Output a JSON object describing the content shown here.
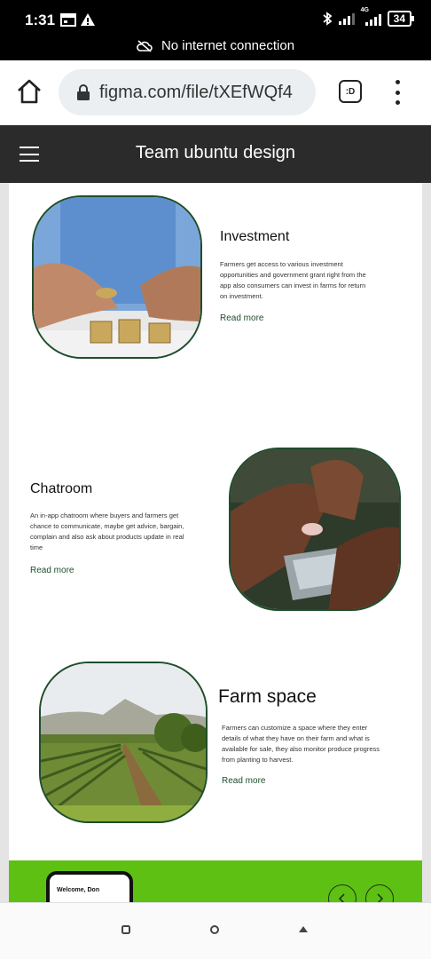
{
  "status_bar": {
    "time": "1:31",
    "network_type": "4G",
    "battery": "34",
    "offline_message": "No internet connection"
  },
  "browser": {
    "url": "figma.com/file/tXEfWQf4",
    "tabs_label": ":D"
  },
  "site": {
    "title": "Team ubuntu design"
  },
  "features": [
    {
      "title": "Investment",
      "description": "Farmers get access to various investment opportunities and government grant right from the app also consumers can invest in farms for return on investment.",
      "link": "Read more",
      "image_icon": "coins-photo"
    },
    {
      "title": "Chatroom",
      "description": "An in-app chatroom where buyers and farmers get chance to communicate, maybe get advice, bargain, complain and also ask about products update in real time",
      "link": "Read more",
      "image_icon": "phone-hands-photo"
    },
    {
      "title": "Farm space",
      "description": "Farmers can customize a space where they enter details of what they have on their farm and what is available for sale, they also monitor produce progress from planting to harvest.",
      "link": "Read more",
      "image_icon": "vineyard-photo"
    }
  ],
  "promo": {
    "greeting": "Welcome, Don",
    "prev_icon": "chevron-left-icon",
    "next_icon": "chevron-right-icon"
  },
  "colors": {
    "header_bg": "#2b2b2b",
    "accent_green": "#1e4d2b",
    "band_green": "#5ec013"
  }
}
